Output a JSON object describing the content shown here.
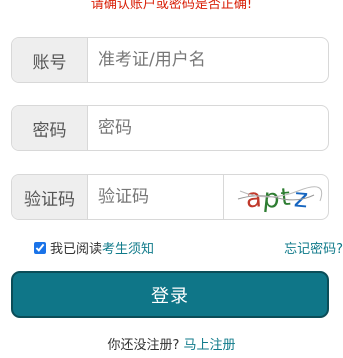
{
  "error_message": "请确认账户或密码是否正确!",
  "username": {
    "label": "账号",
    "placeholder": "准考证/用户名",
    "value": ""
  },
  "password": {
    "label": "密码",
    "placeholder": "密码",
    "value": ""
  },
  "captcha": {
    "label": "验证码",
    "placeholder": "验证码",
    "value": "",
    "image_text": "aptz"
  },
  "agreement": {
    "checked": true,
    "prefix": "我已阅读",
    "link": "考生须知"
  },
  "forgot_link": "忘记密码?",
  "login_button": "登录",
  "register": {
    "prompt": "你还没注册?",
    "link": "马上注册"
  },
  "colors": {
    "primary": "#0f7688",
    "error": "#d81e06",
    "link": "#0f7a8a"
  }
}
